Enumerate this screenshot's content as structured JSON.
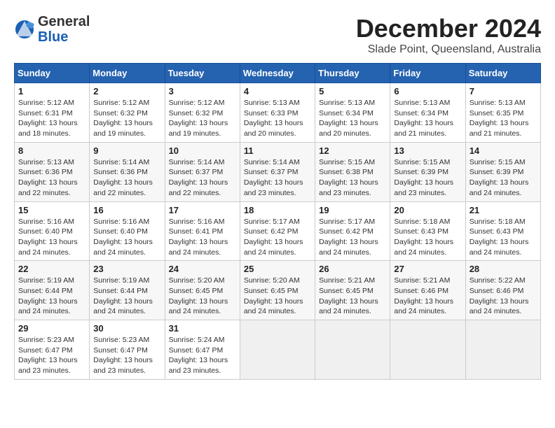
{
  "logo": {
    "general": "General",
    "blue": "Blue"
  },
  "title": "December 2024",
  "subtitle": "Slade Point, Queensland, Australia",
  "headers": [
    "Sunday",
    "Monday",
    "Tuesday",
    "Wednesday",
    "Thursday",
    "Friday",
    "Saturday"
  ],
  "weeks": [
    [
      {
        "day": "1",
        "sunrise": "5:12 AM",
        "sunset": "6:31 PM",
        "daylight": "13 hours and 18 minutes."
      },
      {
        "day": "2",
        "sunrise": "5:12 AM",
        "sunset": "6:32 PM",
        "daylight": "13 hours and 19 minutes."
      },
      {
        "day": "3",
        "sunrise": "5:12 AM",
        "sunset": "6:32 PM",
        "daylight": "13 hours and 19 minutes."
      },
      {
        "day": "4",
        "sunrise": "5:13 AM",
        "sunset": "6:33 PM",
        "daylight": "13 hours and 20 minutes."
      },
      {
        "day": "5",
        "sunrise": "5:13 AM",
        "sunset": "6:34 PM",
        "daylight": "13 hours and 20 minutes."
      },
      {
        "day": "6",
        "sunrise": "5:13 AM",
        "sunset": "6:34 PM",
        "daylight": "13 hours and 21 minutes."
      },
      {
        "day": "7",
        "sunrise": "5:13 AM",
        "sunset": "6:35 PM",
        "daylight": "13 hours and 21 minutes."
      }
    ],
    [
      {
        "day": "8",
        "sunrise": "5:13 AM",
        "sunset": "6:36 PM",
        "daylight": "13 hours and 22 minutes."
      },
      {
        "day": "9",
        "sunrise": "5:14 AM",
        "sunset": "6:36 PM",
        "daylight": "13 hours and 22 minutes."
      },
      {
        "day": "10",
        "sunrise": "5:14 AM",
        "sunset": "6:37 PM",
        "daylight": "13 hours and 22 minutes."
      },
      {
        "day": "11",
        "sunrise": "5:14 AM",
        "sunset": "6:37 PM",
        "daylight": "13 hours and 23 minutes."
      },
      {
        "day": "12",
        "sunrise": "5:15 AM",
        "sunset": "6:38 PM",
        "daylight": "13 hours and 23 minutes."
      },
      {
        "day": "13",
        "sunrise": "5:15 AM",
        "sunset": "6:39 PM",
        "daylight": "13 hours and 23 minutes."
      },
      {
        "day": "14",
        "sunrise": "5:15 AM",
        "sunset": "6:39 PM",
        "daylight": "13 hours and 24 minutes."
      }
    ],
    [
      {
        "day": "15",
        "sunrise": "5:16 AM",
        "sunset": "6:40 PM",
        "daylight": "13 hours and 24 minutes."
      },
      {
        "day": "16",
        "sunrise": "5:16 AM",
        "sunset": "6:40 PM",
        "daylight": "13 hours and 24 minutes."
      },
      {
        "day": "17",
        "sunrise": "5:16 AM",
        "sunset": "6:41 PM",
        "daylight": "13 hours and 24 minutes."
      },
      {
        "day": "18",
        "sunrise": "5:17 AM",
        "sunset": "6:42 PM",
        "daylight": "13 hours and 24 minutes."
      },
      {
        "day": "19",
        "sunrise": "5:17 AM",
        "sunset": "6:42 PM",
        "daylight": "13 hours and 24 minutes."
      },
      {
        "day": "20",
        "sunrise": "5:18 AM",
        "sunset": "6:43 PM",
        "daylight": "13 hours and 24 minutes."
      },
      {
        "day": "21",
        "sunrise": "5:18 AM",
        "sunset": "6:43 PM",
        "daylight": "13 hours and 24 minutes."
      }
    ],
    [
      {
        "day": "22",
        "sunrise": "5:19 AM",
        "sunset": "6:44 PM",
        "daylight": "13 hours and 24 minutes."
      },
      {
        "day": "23",
        "sunrise": "5:19 AM",
        "sunset": "6:44 PM",
        "daylight": "13 hours and 24 minutes."
      },
      {
        "day": "24",
        "sunrise": "5:20 AM",
        "sunset": "6:45 PM",
        "daylight": "13 hours and 24 minutes."
      },
      {
        "day": "25",
        "sunrise": "5:20 AM",
        "sunset": "6:45 PM",
        "daylight": "13 hours and 24 minutes."
      },
      {
        "day": "26",
        "sunrise": "5:21 AM",
        "sunset": "6:45 PM",
        "daylight": "13 hours and 24 minutes."
      },
      {
        "day": "27",
        "sunrise": "5:21 AM",
        "sunset": "6:46 PM",
        "daylight": "13 hours and 24 minutes."
      },
      {
        "day": "28",
        "sunrise": "5:22 AM",
        "sunset": "6:46 PM",
        "daylight": "13 hours and 24 minutes."
      }
    ],
    [
      {
        "day": "29",
        "sunrise": "5:23 AM",
        "sunset": "6:47 PM",
        "daylight": "13 hours and 23 minutes."
      },
      {
        "day": "30",
        "sunrise": "5:23 AM",
        "sunset": "6:47 PM",
        "daylight": "13 hours and 23 minutes."
      },
      {
        "day": "31",
        "sunrise": "5:24 AM",
        "sunset": "6:47 PM",
        "daylight": "13 hours and 23 minutes."
      },
      null,
      null,
      null,
      null
    ]
  ]
}
